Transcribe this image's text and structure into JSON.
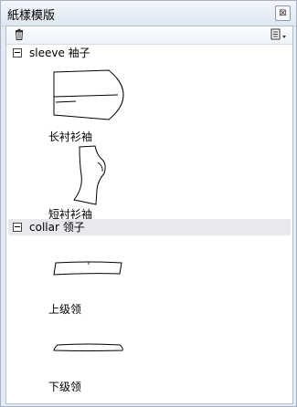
{
  "window": {
    "title": "紙樣模版",
    "close_icon": "close-icon"
  },
  "toolbar": {
    "delete_icon": "trash-icon",
    "menu_icon": "document-menu-icon"
  },
  "groups": [
    {
      "label": "sleeve 袖子",
      "items": [
        {
          "label": "长衬衫袖",
          "icon": "long-sleeve-pattern-icon"
        },
        {
          "label": "短衬衫袖",
          "icon": "short-sleeve-pattern-icon"
        }
      ]
    },
    {
      "label": "collar 领子",
      "items": [
        {
          "label": "上级领",
          "icon": "upper-collar-pattern-icon"
        },
        {
          "label": "下级领",
          "icon": "lower-collar-pattern-icon"
        }
      ]
    }
  ]
}
